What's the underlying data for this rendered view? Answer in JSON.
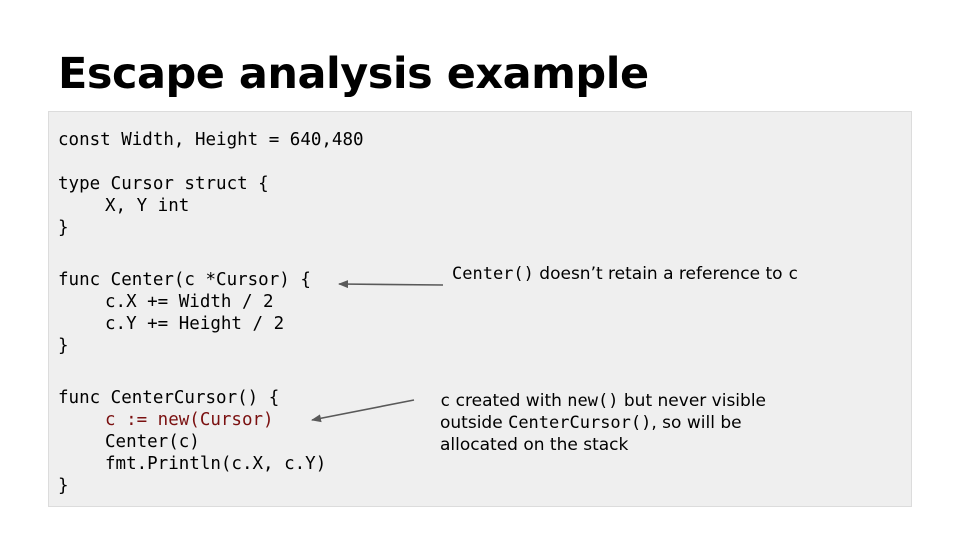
{
  "slide": {
    "title": "Escape analysis example"
  },
  "code": {
    "line1": "const Width, Height = 640,480",
    "line2": "type Cursor struct {",
    "line3": "X, Y int",
    "line4": "}",
    "line5": "func Center(c *Cursor) {",
    "line6": "c.X += Width / 2",
    "line7": "c.Y += Height / 2",
    "line8": "}",
    "line9": "func CenterCursor() {",
    "line10": "c := new(Cursor)",
    "line11": "Center(c)",
    "line12": "fmt.Println(c.X, c.Y)",
    "line13": "}"
  },
  "notes": {
    "note1_code": "Center()",
    "note1_text": " doesn’t retain a reference to ",
    "note1_var": "c",
    "note2_var": "c",
    "note2_text_a": " created with ",
    "note2_new": "new()",
    "note2_text_b": " but never visible",
    "note2_text_c": "outside ",
    "note2_func": "CenterCursor()",
    "note2_text_d": ", so will be",
    "note2_line3": "allocated on the stack"
  },
  "colors": {
    "highlight": "#7a1010",
    "code_background": "#efefef",
    "arrow": "#595959"
  }
}
